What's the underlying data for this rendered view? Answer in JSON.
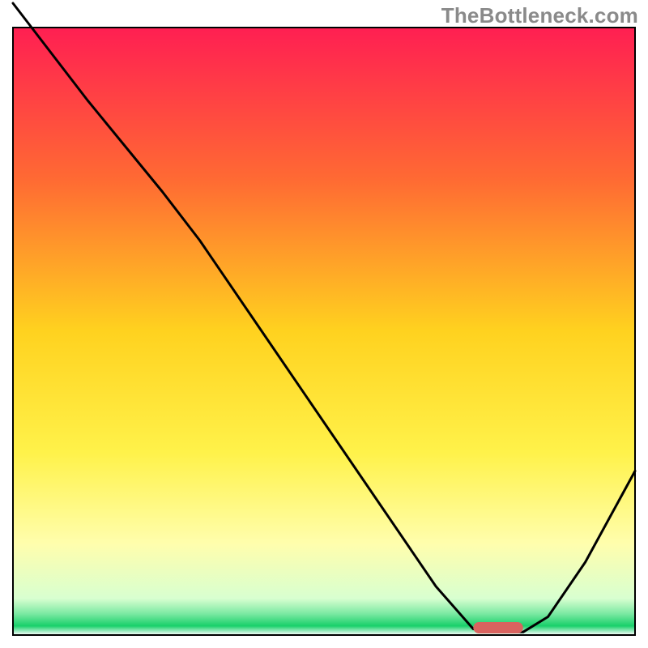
{
  "watermark": "TheBottleneck.com",
  "chart_data": {
    "type": "line",
    "title": "",
    "xlabel": "",
    "ylabel": "",
    "xlim": [
      0,
      100
    ],
    "ylim": [
      0,
      100
    ],
    "axes_visible": false,
    "legend": false,
    "background_gradient_stops": [
      {
        "offset": 0.0,
        "color": "#ff1f52"
      },
      {
        "offset": 0.25,
        "color": "#ff6a33"
      },
      {
        "offset": 0.5,
        "color": "#ffd21f"
      },
      {
        "offset": 0.7,
        "color": "#fff24a"
      },
      {
        "offset": 0.85,
        "color": "#fffead"
      },
      {
        "offset": 0.94,
        "color": "#d8ffd0"
      },
      {
        "offset": 0.965,
        "color": "#7be9a2"
      },
      {
        "offset": 0.985,
        "color": "#18d06a"
      },
      {
        "offset": 1.0,
        "color": "#ffffff"
      }
    ],
    "curve": {
      "description": "Bottleneck / deviation curve. Y ≈ 100 means severe (top, red), Y ≈ 0 means ideal (bottom, green). Minimum plateau marks recommended configuration.",
      "points": [
        {
          "x": 0,
          "y": 104
        },
        {
          "x": 12,
          "y": 88
        },
        {
          "x": 24,
          "y": 73
        },
        {
          "x": 30,
          "y": 65
        },
        {
          "x": 40,
          "y": 50
        },
        {
          "x": 50,
          "y": 35
        },
        {
          "x": 60,
          "y": 20
        },
        {
          "x": 68,
          "y": 8
        },
        {
          "x": 74,
          "y": 1
        },
        {
          "x": 78,
          "y": 0.5
        },
        {
          "x": 82,
          "y": 0.5
        },
        {
          "x": 86,
          "y": 3
        },
        {
          "x": 92,
          "y": 12
        },
        {
          "x": 100,
          "y": 27
        }
      ]
    },
    "marker": {
      "description": "Highlighted recommended range at curve minimum",
      "x_start": 74,
      "x_end": 82,
      "y": 1.2,
      "color": "#d9635f"
    },
    "frame": {
      "stroke": "#000000",
      "stroke_width": 2
    }
  }
}
